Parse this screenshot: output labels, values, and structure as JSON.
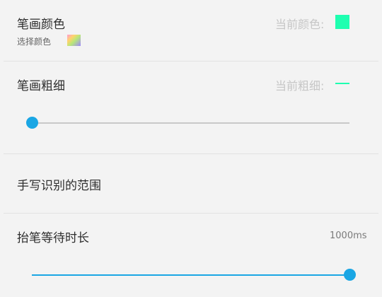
{
  "colors": {
    "accent": "#1aa6e4",
    "current_color": "#1effb0",
    "track_inactive": "#c9c9c9"
  },
  "pen_color": {
    "title": "笔画颜色",
    "subtitle": "选择颜色",
    "current_label": "当前颜色:",
    "palette_icon": "gradient-palette-icon"
  },
  "pen_width": {
    "title": "笔画粗细",
    "current_label": "当前粗细:",
    "slider_value": 0
  },
  "recognition_range": {
    "title": "手写识别的范围"
  },
  "wait_duration": {
    "title": "抬笔等待时长",
    "value_text": "1000ms",
    "slider_value": 1
  }
}
